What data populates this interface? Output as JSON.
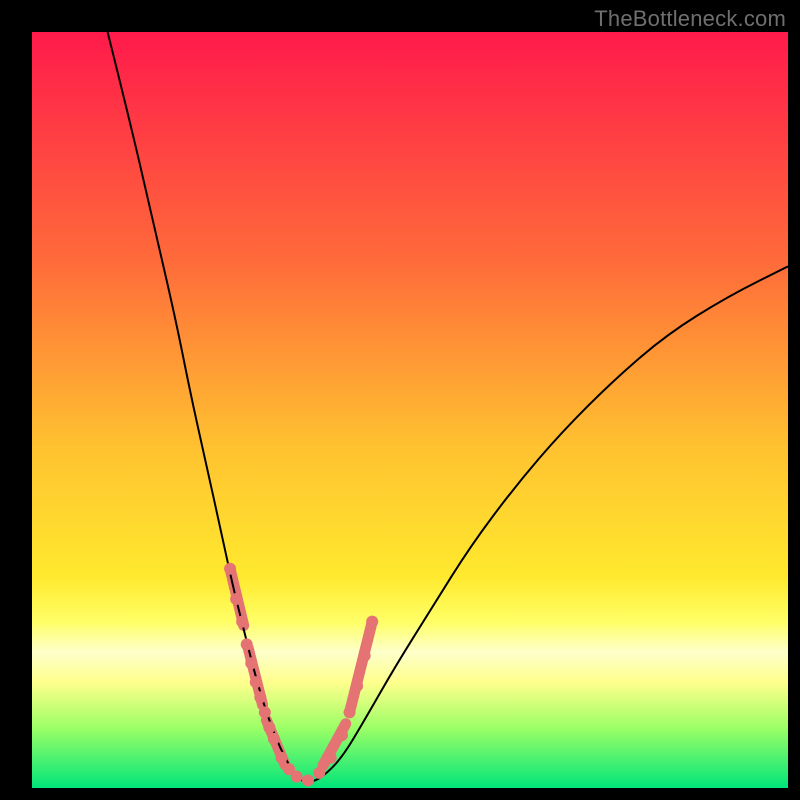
{
  "watermark": "TheBottleneck.com",
  "chart_data": {
    "type": "line",
    "title": "",
    "xlabel": "",
    "ylabel": "",
    "xlim": [
      0,
      100
    ],
    "ylim": [
      0,
      100
    ],
    "grid": false,
    "legend": false,
    "background_gradient": {
      "orientation": "vertical",
      "stops": [
        {
          "offset": 0,
          "color": "#ff1a4b"
        },
        {
          "offset": 30,
          "color": "#ff6a3a"
        },
        {
          "offset": 55,
          "color": "#ffc230"
        },
        {
          "offset": 72,
          "color": "#ffe92e"
        },
        {
          "offset": 78,
          "color": "#ffff66"
        },
        {
          "offset": 82,
          "color": "#fdffc9"
        },
        {
          "offset": 86,
          "color": "#ffff8d"
        },
        {
          "offset": 92,
          "color": "#9dff66"
        },
        {
          "offset": 100,
          "color": "#00e57a"
        }
      ]
    },
    "series": [
      {
        "name": "bottleneck-curve",
        "color": "#000000",
        "stroke_width": 2,
        "x": [
          10,
          13,
          16,
          19,
          21,
          23,
          25,
          26.5,
          28,
          29.5,
          31,
          32.5,
          34,
          35,
          36,
          37,
          38.5,
          41,
          44,
          48,
          53,
          58,
          64,
          70,
          77,
          84,
          92,
          100
        ],
        "y": [
          100,
          88,
          75,
          62,
          52,
          43,
          34,
          27,
          21,
          15,
          10,
          6,
          3,
          1.5,
          0.8,
          0.8,
          1.5,
          4,
          9,
          16,
          24,
          32,
          40,
          47,
          54,
          60,
          65,
          69
        ]
      },
      {
        "name": "data-points-cluster",
        "type": "scatter",
        "color": "#e57373",
        "marker_radius": 6,
        "x": [
          26.2,
          27.0,
          27.8,
          28.4,
          29.0,
          29.6,
          30.2,
          30.8,
          31.4,
          32.0,
          33.0,
          34.0,
          35.0,
          36.5,
          38.0,
          39.5,
          41.0,
          42.0,
          43.0,
          44.0,
          45.0
        ],
        "y": [
          29.0,
          25.0,
          22.0,
          19.0,
          16.5,
          14.0,
          12.0,
          10.0,
          8.0,
          6.5,
          4.0,
          2.5,
          1.5,
          1.0,
          2.0,
          4.0,
          7.0,
          10.0,
          13.5,
          17.5,
          22.0
        ]
      },
      {
        "name": "data-segments-left",
        "type": "line",
        "color": "#e57373",
        "stroke_width": 11,
        "segments": [
          {
            "x": [
              26.2,
              28.0
            ],
            "y": [
              29.0,
              21.5
            ]
          },
          {
            "x": [
              28.6,
              30.5
            ],
            "y": [
              18.5,
              11.0
            ]
          },
          {
            "x": [
              31.0,
              33.5
            ],
            "y": [
              9.0,
              3.0
            ]
          }
        ]
      },
      {
        "name": "data-segments-right",
        "type": "line",
        "color": "#e57373",
        "stroke_width": 11,
        "segments": [
          {
            "x": [
              38.5,
              41.5
            ],
            "y": [
              3.0,
              8.5
            ]
          },
          {
            "x": [
              42.0,
              45.0
            ],
            "y": [
              10.0,
              22.0
            ]
          }
        ]
      }
    ]
  }
}
